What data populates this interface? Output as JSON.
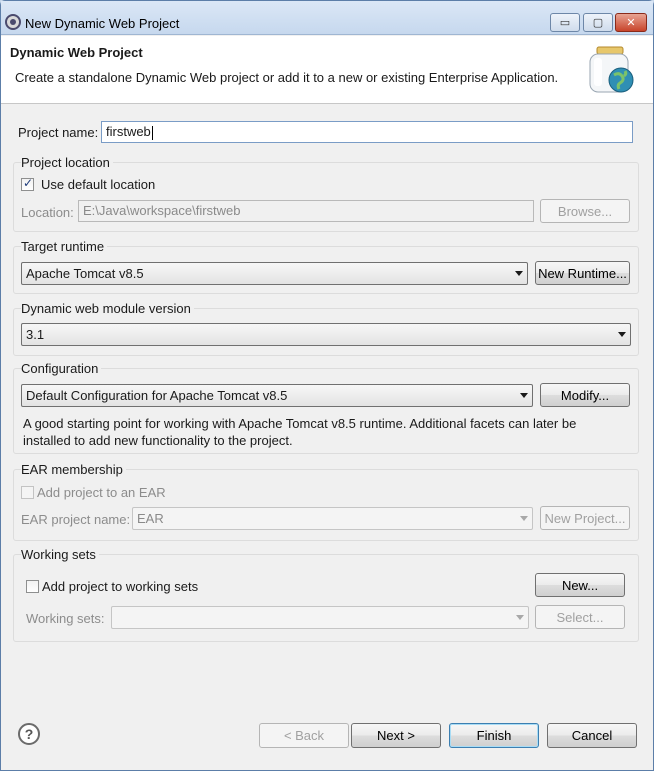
{
  "window": {
    "title": "New Dynamic Web Project",
    "minimize_glyph": "▭",
    "maximize_glyph": "▢",
    "close_glyph": "✕"
  },
  "banner": {
    "title": "Dynamic Web Project",
    "description": "Create a standalone Dynamic Web project or add it to a new or existing Enterprise Application."
  },
  "project_name": {
    "label": "Project name:",
    "value": "firstweb"
  },
  "project_location": {
    "group_title": "Project location",
    "use_default_label": "Use default location",
    "use_default_checked": true,
    "location_label": "Location:",
    "location_value": "E:\\Java\\workspace\\firstweb",
    "browse_label": "Browse..."
  },
  "target_runtime": {
    "group_title": "Target runtime",
    "selected": "Apache Tomcat v8.5",
    "new_runtime_label": "New Runtime..."
  },
  "module_version": {
    "group_title": "Dynamic web module version",
    "selected": "3.1"
  },
  "configuration": {
    "group_title": "Configuration",
    "selected": "Default Configuration for Apache Tomcat v8.5",
    "modify_label": "Modify...",
    "description_line1": "A good starting point for working with Apache Tomcat v8.5 runtime. Additional facets can later be",
    "description_line2": "installed to add new functionality to the project."
  },
  "ear_membership": {
    "group_title": "EAR membership",
    "add_label": "Add project to an EAR",
    "add_checked": false,
    "name_label": "EAR project name:",
    "name_value": "EAR",
    "new_project_label": "New Project..."
  },
  "working_sets": {
    "group_title": "Working sets",
    "add_label": "Add project to working sets",
    "add_checked": false,
    "new_label": "New...",
    "sets_label": "Working sets:",
    "sets_value": "",
    "select_label": "Select..."
  },
  "footer": {
    "help_glyph": "?",
    "back_label": "< Back",
    "next_label": "Next >",
    "finish_label": "Finish",
    "cancel_label": "Cancel"
  }
}
